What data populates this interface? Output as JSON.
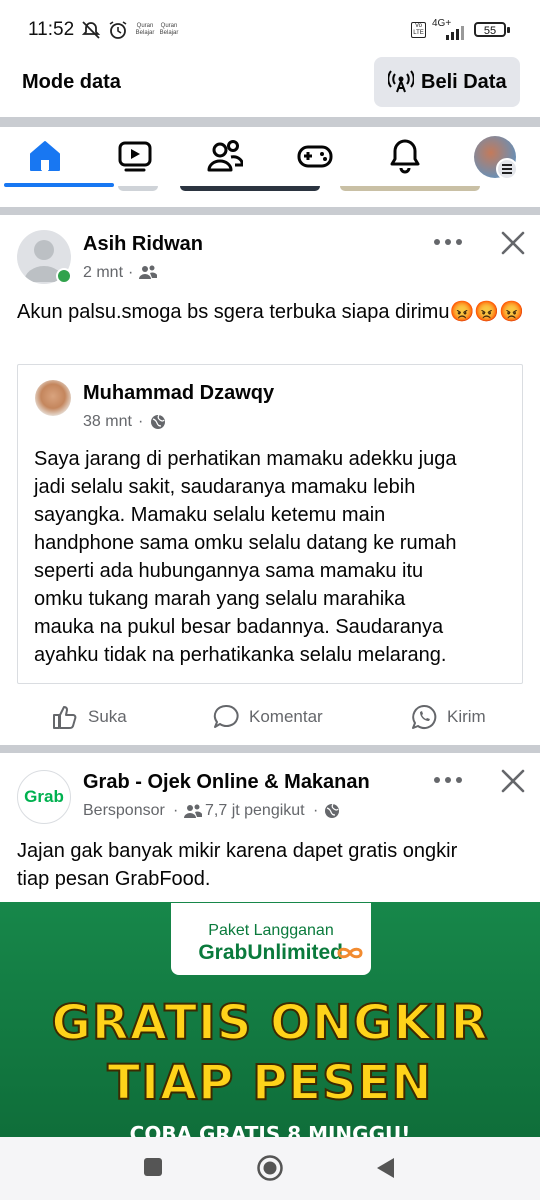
{
  "status": {
    "time": "11:52",
    "app_label_1": "Quran Belajar",
    "app_label_2": "Quran Belajar",
    "network": "4G+",
    "battery": "55"
  },
  "databar": {
    "mode_label": "Mode data",
    "buy_label": "Beli Data"
  },
  "nav": {
    "items": [
      "home-icon",
      "video-icon",
      "friends-icon",
      "gaming-icon",
      "notifications-icon",
      "profile-menu-icon"
    ],
    "active": "home-icon",
    "accent": "#1877f2"
  },
  "post1": {
    "author": "Asih Ridwan",
    "time": "2 mnt",
    "audience_icon": "friends-icon",
    "text": "Akun palsu.smoga bs sgera terbuka siapa dirimu",
    "emoji": "😡😡😡",
    "shared": {
      "author": "Muhammad Dzawqy",
      "time": "38 mnt",
      "audience_icon": "globe-icon",
      "lines": [
        "Saya jarang di perhatikan mamaku adekku juga",
        "jadi selalu sakit, saudaranya mamaku lebih",
        "sayangka. Mamaku selalu ketemu main",
        "handphone sama omku selalu datang ke rumah",
        "seperti ada hubungannya sama mamaku itu",
        "omku tukang marah yang selalu marahika",
        "mauka na pukul besar badannya. Saudaranya",
        "ayahku tidak na perhatikanka  selalu melarang."
      ]
    },
    "actions": {
      "like": "Suka",
      "comment": "Komentar",
      "send": "Kirim"
    }
  },
  "post2": {
    "author": "Grab - Ojek Online & Makanan",
    "logo_text": "Grab",
    "sponsored": "Bersponsor",
    "followers": "7,7 jt pengikut",
    "text_lines": [
      "Jajan gak banyak mikir karena dapet gratis ongkir",
      "tiap pesan GrabFood."
    ],
    "banner": {
      "card_line1": "Paket Langganan",
      "card_line2": "GrabUnlimited",
      "headline1": "GRATIS ONGKIR",
      "headline2": "TIAP PESEN",
      "subline": "COBA GRATIS 8 MINGGU!"
    }
  },
  "colors": {
    "brand_blue": "#1877f2",
    "grab_green": "#00b14f",
    "banner_yellow": "#ffd31a"
  }
}
